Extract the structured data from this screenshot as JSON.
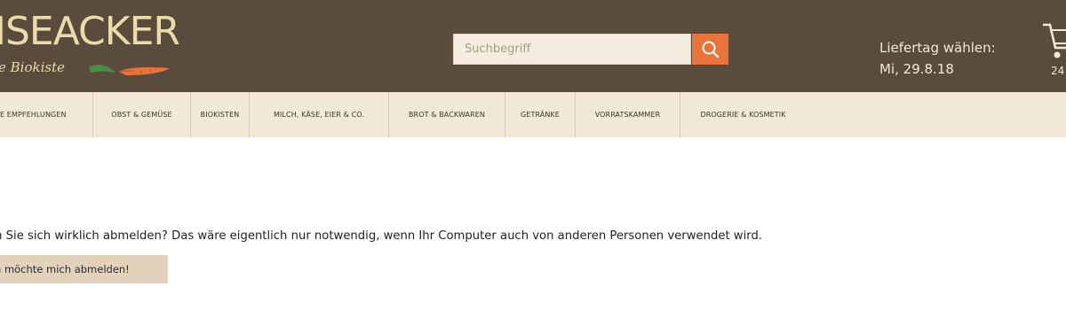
{
  "header": {
    "logo_text": "ISEACKER",
    "logo_subtitle": "e Biokiste",
    "search": {
      "placeholder": "Suchbegriff",
      "value": ""
    },
    "delivery": {
      "label": "Liefertag wählen:",
      "date": "Mi, 29.8.18"
    },
    "cart": {
      "count_text": "24"
    }
  },
  "nav": {
    "items": [
      {
        "label": "E EMPFEHLUNGEN"
      },
      {
        "label": "OBST & GEMÜSE"
      },
      {
        "label": "BIOKISTEN"
      },
      {
        "label": "MILCH, KÄSE, EIER & CO."
      },
      {
        "label": "BROT & BACKWAREN"
      },
      {
        "label": "GETRÄNKE"
      },
      {
        "label": "VORRATSKAMMER"
      },
      {
        "label": "DROGERIE & KOSMETIK"
      }
    ]
  },
  "main": {
    "message": "en Sie sich wirklich abmelden? Das wäre eigentlich nur notwendig, wenn Ihr Computer auch von anderen Personen verwendet wird.",
    "logout_button_label": "h möchte mich abmelden!"
  },
  "colors": {
    "header_bg": "#5a4c3c",
    "nav_bg": "#f2e8da",
    "accent_orange": "#e8743a",
    "logo_cream": "#e9dcaa",
    "button_bg": "#e2d2bc"
  },
  "icons": {
    "search": "magnifier-icon",
    "cart": "cart-icon",
    "logo_art": "carrot-icon"
  }
}
